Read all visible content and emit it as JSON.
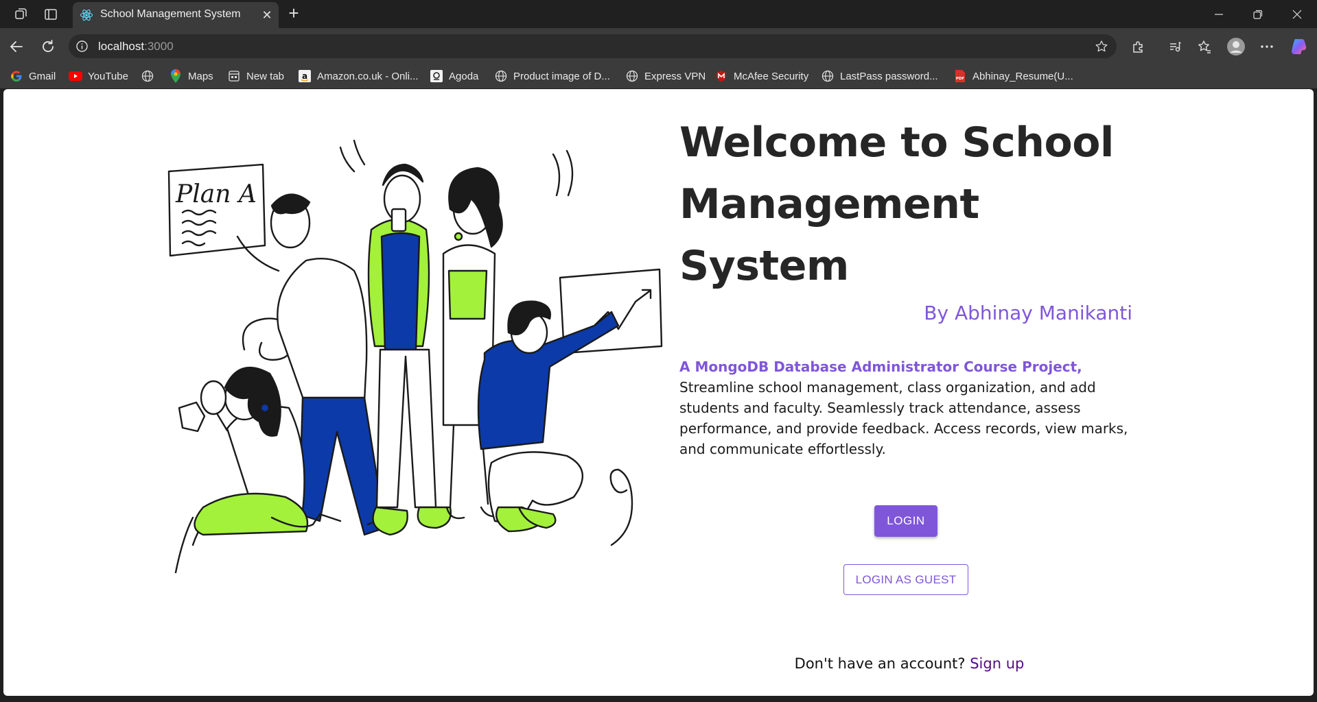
{
  "browser": {
    "tab_title": "School Management System",
    "new_tab_symbol": "+",
    "address": {
      "host": "localhost",
      "port": ":3000"
    },
    "icons": {
      "workspaces": "workspaces-icon",
      "tab_actions": "tab-actions-icon",
      "favicon": "react-icon",
      "back": "back-arrow-icon",
      "reload": "reload-icon",
      "site_info": "info-icon",
      "favorite": "star-icon",
      "extensions": "puzzle-icon",
      "media": "media-icon",
      "favorites": "favorites-icon",
      "profile": "profile-avatar-icon",
      "more": "more-icon",
      "copilot": "copilot-icon"
    },
    "bookmarks": [
      {
        "label": "Gmail",
        "icon": "google-icon"
      },
      {
        "label": "YouTube",
        "icon": "youtube-icon"
      },
      {
        "label": "",
        "icon": "globe-icon"
      },
      {
        "label": "Maps",
        "icon": "maps-pin-icon"
      },
      {
        "label": "New tab",
        "icon": "new-tab-icon"
      },
      {
        "label": "Amazon.co.uk - Onli...",
        "icon": "amazon-icon"
      },
      {
        "label": "Agoda",
        "icon": "agoda-icon"
      },
      {
        "label": "Product image of D...",
        "icon": "globe-icon"
      },
      {
        "label": "Express VPN",
        "icon": "globe-icon"
      },
      {
        "label": "McAfee Security",
        "icon": "mcafee-icon"
      },
      {
        "label": "LastPass password...",
        "icon": "globe-icon"
      },
      {
        "label": "Abhinay_Resume(U...",
        "icon": "pdf-icon"
      }
    ]
  },
  "page": {
    "heading": "Welcome to School Management System",
    "author": "By Abhinay Manikanti",
    "description_highlight": "A MongoDB Database Administrator Course Project,",
    "description": "Streamline school management, class organization, and add students and faculty. Seamlessly track attendance, assess performance, and provide feedback. Access records, view marks, and communicate effortlessly.",
    "login_label": "LOGIN",
    "guest_label": "LOGIN AS GUEST",
    "signup_prompt": "Don't have an account?",
    "signup_link": "Sign up",
    "illustration_text": "Plan A",
    "colors": {
      "accent": "#7f56da",
      "link": "#550a82",
      "lime": "#a3f13b",
      "blue": "#0c3aa8"
    }
  }
}
